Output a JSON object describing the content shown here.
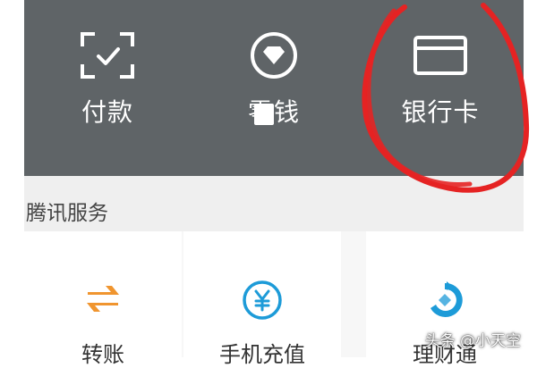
{
  "wallet": {
    "items": [
      {
        "label": "付款",
        "icon": "scan-pay-icon"
      },
      {
        "label": "零钱",
        "icon": "diamond-coin-icon"
      },
      {
        "label": "银行卡",
        "icon": "bank-card-icon"
      }
    ]
  },
  "tencent_services": {
    "title": "腾讯服务",
    "items": [
      {
        "label": "转账",
        "icon": "transfer-arrows-icon",
        "color": "#f0952f"
      },
      {
        "label": "手机充值",
        "icon": "yuan-icon",
        "color": "#1d9bd8"
      },
      {
        "label": "理财通",
        "icon": "wealth-icon",
        "color": "#1d9bd8"
      }
    ]
  },
  "watermark": "头条 @小天空",
  "colors": {
    "panel": "#5f6467",
    "section_bg": "#efefef",
    "annotation_red": "#e52323"
  }
}
